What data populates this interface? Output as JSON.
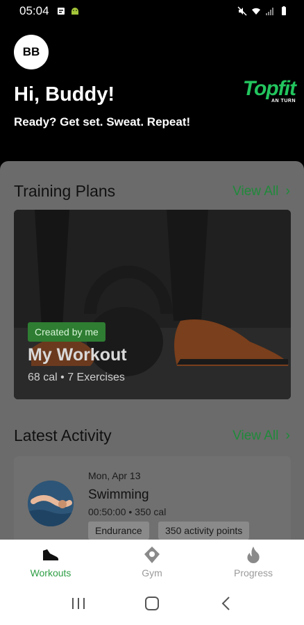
{
  "status_bar": {
    "time": "05:04",
    "icons": [
      "message-icon",
      "android-icon",
      "mute-icon",
      "wifi-icon",
      "signal-icon",
      "battery-icon"
    ]
  },
  "header": {
    "avatar_initials": "BB",
    "greeting": "Hi, Buddy!",
    "tagline": "Ready? Get set. Sweat. Repeat!",
    "brand_name": "Topfit",
    "brand_sub": "AN TURN"
  },
  "training_plans": {
    "title": "Training Plans",
    "view_all": "View All",
    "card": {
      "badge": "Created by me",
      "title": "My Workout",
      "meta": "68 cal • 7 Exercises"
    }
  },
  "latest_activity": {
    "title": "Latest Activity",
    "view_all": "View All",
    "item": {
      "date": "Mon, Apr 13",
      "name": "Swimming",
      "meta": "00:50:00 • 350 cal",
      "chips": [
        "Endurance",
        "350 activity points"
      ]
    }
  },
  "bottom_nav": {
    "items": [
      {
        "label": "Workouts",
        "icon": "shoe-icon",
        "active": true
      },
      {
        "label": "Gym",
        "icon": "location-pin-icon",
        "active": false
      },
      {
        "label": "Progress",
        "icon": "flame-icon",
        "active": false
      }
    ]
  },
  "colors": {
    "accent": "#2e9e44",
    "brand": "#22c55e",
    "overlay": "#6b6b6b"
  }
}
